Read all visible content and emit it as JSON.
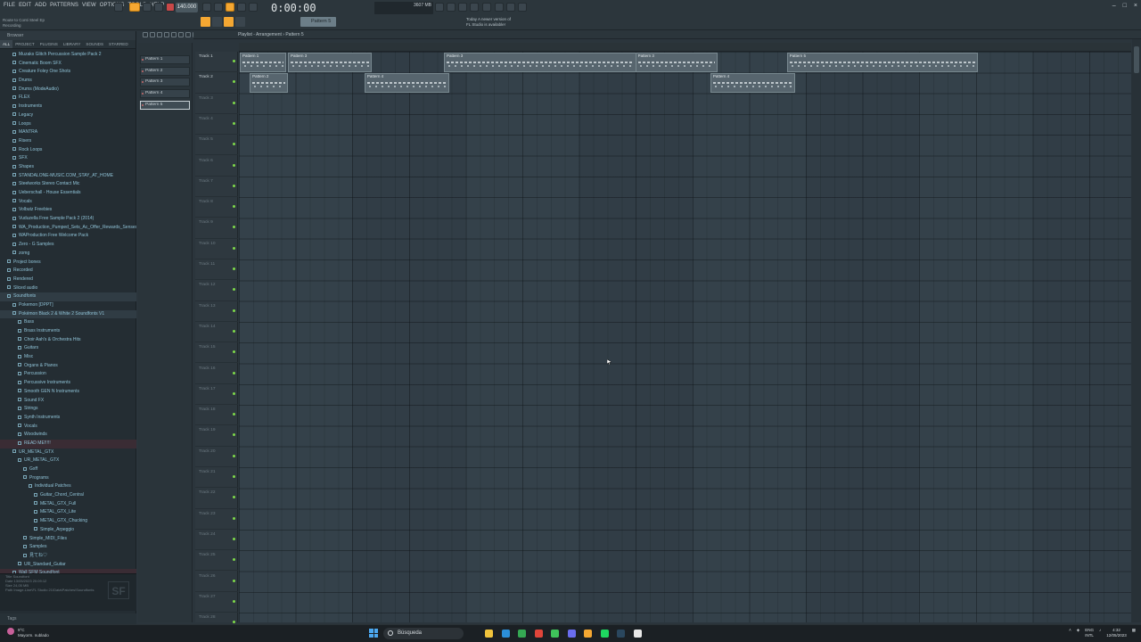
{
  "app": {
    "menu": [
      "FILE",
      "EDIT",
      "ADD",
      "PATTERNS",
      "VIEW",
      "OPTIONS",
      "TOOLS",
      "HELP"
    ],
    "hint_line1": "Route to Conti Steel Ep",
    "hint_line2": "Recording",
    "tempo": "140.000",
    "clock": "0:00:00",
    "cpu": "3607 MB",
    "pattern_selector": "Pattern 5",
    "news_line1": "Today   A newer version of",
    "news_line2": "FL Studio is available!"
  },
  "colors": {
    "accent": "#f4a732",
    "clip": "#57656e",
    "grid": "#34414a",
    "led": "#7ed94a"
  },
  "browser": {
    "title": "Browser",
    "tabs": [
      "ALL",
      "PROJECT",
      "PLUGINS",
      "LIBRARY",
      "SOUNDS",
      "STARRED"
    ],
    "items": [
      {
        "label": "Muzaks Glitch Percussion Sample Pack 2",
        "indent": 1
      },
      {
        "label": "Cinematic Boom SFX",
        "indent": 1
      },
      {
        "label": "Creature Foley One Shots",
        "indent": 1
      },
      {
        "label": "Drums",
        "indent": 1
      },
      {
        "label": "Drums (ModeAudio)",
        "indent": 1
      },
      {
        "label": "FLEX",
        "indent": 1
      },
      {
        "label": "Instruments",
        "indent": 1
      },
      {
        "label": "Legacy",
        "indent": 1
      },
      {
        "label": "Loops",
        "indent": 1
      },
      {
        "label": "MANTRA",
        "indent": 1
      },
      {
        "label": "Risers",
        "indent": 1
      },
      {
        "label": "Rock Loops",
        "indent": 1
      },
      {
        "label": "SFX",
        "indent": 1
      },
      {
        "label": "Shapes",
        "indent": 1
      },
      {
        "label": "STANDALONE-MUSIC.COM_STAY_AT_HOME",
        "indent": 1
      },
      {
        "label": "Steelworks Stereo Contact Mic",
        "indent": 1
      },
      {
        "label": "Ueberschall - House Essentials",
        "indent": 1
      },
      {
        "label": "Vocals",
        "indent": 1
      },
      {
        "label": "Volbutz Freebies",
        "indent": 1
      },
      {
        "label": "Vuduzella Free Sample Pack 2 (2014)",
        "indent": 1
      },
      {
        "label": "WA_Production_Pumped_Sets_Ac_Offer_Rewards_Senses",
        "indent": 1
      },
      {
        "label": "WAProduction Free Welcome Pack",
        "indent": 1
      },
      {
        "label": "Zero - G Samples",
        "indent": 1
      },
      {
        "label": "zomg",
        "indent": 1
      },
      {
        "label": "Project bones",
        "indent": 0
      },
      {
        "label": "Recorded",
        "indent": 0
      },
      {
        "label": "Rendered",
        "indent": 0
      },
      {
        "label": "Sliced audio",
        "indent": 0
      },
      {
        "label": "Soundfonts",
        "indent": 0,
        "selected": true
      },
      {
        "label": "Pokemon [DPPT]",
        "indent": 1
      },
      {
        "label": "Pokémon Black 2 & White 2 Soundfonts V1",
        "indent": 1,
        "selected": true
      },
      {
        "label": "Bass",
        "indent": 2
      },
      {
        "label": "Brass Instruments",
        "indent": 2
      },
      {
        "label": "Choir Aah's & Orchestra Hits",
        "indent": 2
      },
      {
        "label": "Guitars",
        "indent": 2
      },
      {
        "label": "Misc",
        "indent": 2
      },
      {
        "label": "Organs & Pianos",
        "indent": 2
      },
      {
        "label": "Percussion",
        "indent": 2
      },
      {
        "label": "Percussive Instruments",
        "indent": 2
      },
      {
        "label": "Smooth GEN N Instruments",
        "indent": 2
      },
      {
        "label": "Sound FX",
        "indent": 2
      },
      {
        "label": "Strings",
        "indent": 2
      },
      {
        "label": "Synth Instruments",
        "indent": 2
      },
      {
        "label": "Vocals",
        "indent": 2
      },
      {
        "label": "Woodwinds",
        "indent": 2
      },
      {
        "label": "READ ME!!!!!",
        "indent": 2,
        "highlight": true
      },
      {
        "label": "UR_METAL_GTX",
        "indent": 1
      },
      {
        "label": "UR_METAL_GTX",
        "indent": 2
      },
      {
        "label": "Gxff",
        "indent": 3
      },
      {
        "label": "Programs",
        "indent": 3
      },
      {
        "label": "Individual Patches",
        "indent": 4
      },
      {
        "label": "Guitar_Chord_Central",
        "indent": 5
      },
      {
        "label": "METAL_GTX_Full",
        "indent": 5
      },
      {
        "label": "METAL_GTX_Lite",
        "indent": 5
      },
      {
        "label": "METAL_GTX_Chucking",
        "indent": 5
      },
      {
        "label": "Simple_Arpeggio",
        "indent": 5
      },
      {
        "label": "Simple_MIDI_Files",
        "indent": 3
      },
      {
        "label": "Samples",
        "indent": 3
      },
      {
        "label": "見てね♡",
        "indent": 3
      },
      {
        "label": "UR_Standard_Guitar",
        "indent": 2
      },
      {
        "label": "Wall SFM Soundfont",
        "indent": 1,
        "highlight": true
      }
    ],
    "info_rows": [
      "Title    Soundfont",
      "Date     13/05/2023 20:09:12",
      "Size     24,05 MB",
      "Path     Image-Line\\FL Studio 21\\Data\\Patches\\Soundfonts"
    ],
    "info_logo": "SF",
    "tags_label": "Tags"
  },
  "patterns": [
    "Pattern 1",
    "Pattern 2",
    "Pattern 3",
    "Pattern 4",
    "Pattern 5"
  ],
  "playlist": {
    "title": "Playlist - Arrangement › Pattern 5",
    "tracks": [
      "Track 1",
      "Track 2",
      "Track 3",
      "Track 4",
      "Track 5",
      "Track 6",
      "Track 7",
      "Track 8",
      "Track 9",
      "Track 10",
      "Track 11",
      "Track 12",
      "Track 13",
      "Track 14",
      "Track 15",
      "Track 16",
      "Track 17",
      "Track 18",
      "Track 19",
      "Track 20",
      "Track 21",
      "Track 22",
      "Track 23",
      "Track 24",
      "Track 25",
      "Track 26",
      "Track 27",
      "Track 28"
    ],
    "clips": [
      {
        "label": "Pattern 1",
        "track": 1,
        "start": 0,
        "length": 3.3
      },
      {
        "label": "Pattern 3",
        "track": 1,
        "start": 3.4,
        "length": 5.9
      },
      {
        "label": "Pattern 3",
        "track": 1,
        "start": 14.4,
        "length": 13.6
      },
      {
        "label": "Pattern 3",
        "track": 1,
        "start": 27.9,
        "length": 5.8
      },
      {
        "label": "Pattern 5",
        "track": 1,
        "start": 38.6,
        "length": 13.5
      },
      {
        "label": "Pattern 2",
        "track": 2,
        "start": 0.7,
        "length": 2.7
      },
      {
        "label": "Pattern 4",
        "track": 2,
        "start": 8.8,
        "length": 6.0
      },
      {
        "label": "Pattern 4",
        "track": 2,
        "start": 33.2,
        "length": 6.0
      }
    ]
  },
  "taskbar": {
    "weather_line1": "9°C",
    "weather_line2": "Mayorm. nublado",
    "search_placeholder": "Búsqueda",
    "apps": [
      "file-explorer",
      "edge",
      "chrome",
      "brave",
      "whatsapp",
      "discord",
      "fl-studio",
      "spotify",
      "steam",
      "capcut"
    ],
    "lang_line1": "ENG",
    "lang_line2": "INTL",
    "time": "4:32",
    "date": "12/05/2023"
  }
}
